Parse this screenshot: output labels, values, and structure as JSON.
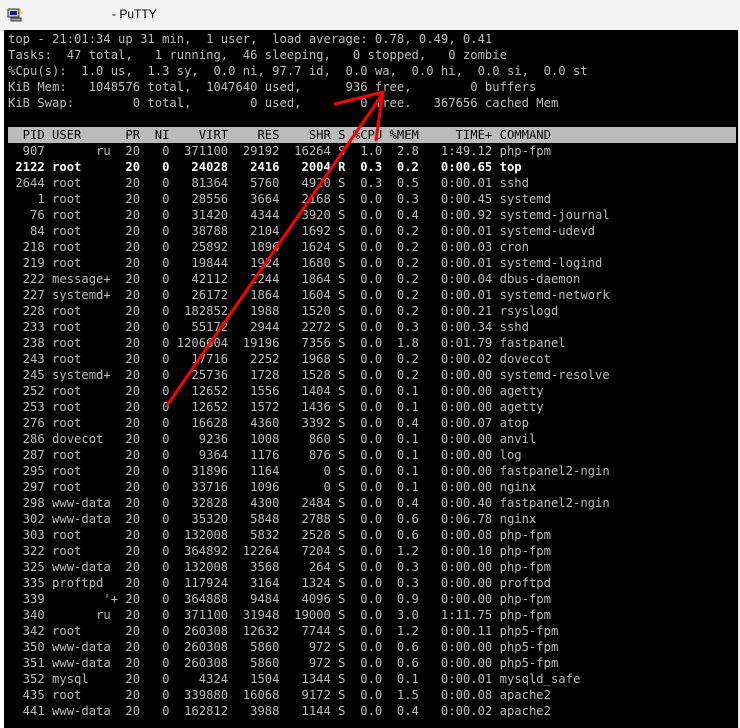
{
  "window": {
    "title": "- PuTTY",
    "accent_color": "#ff0000"
  },
  "summary": [
    "top - 21:01:34 up 31 min,  1 user,  load average: 0.78, 0.49, 0.41",
    "Tasks:  47 total,   1 running,  46 sleeping,   0 stopped,   0 zombie",
    "%Cpu(s):  1.0 us,  1.3 sy,  0.0 ni, 97.7 id,  0.0 wa,  0.0 hi,  0.0 si,  0.0 st",
    "KiB Mem:   1048576 total,  1047640 used,      936 free,        0 buffers",
    "KiB Swap:        0 total,        0 used,        0 free.   367656 cached Mem"
  ],
  "header": "  PID USER      PR  NI    VIRT    RES    SHR S %CPU %MEM     TIME+ COMMAND",
  "processes": [
    "  907       ru  20   0  371100  29192  16264 S  1.0  2.8   1:49.12 php-fpm",
    " 2122 root      20   0   24028   2416   2004 R  0.3  0.2   0:00.65 top",
    " 2644 root      20   0   81364   5760   4920 S  0.3  0.5   0:00.01 sshd",
    "    1 root      20   0   28556   3664   2168 S  0.0  0.3   0:00.45 systemd",
    "   76 root      20   0   31420   4344   3920 S  0.0  0.4   0:00.92 systemd-journal",
    "   84 root      20   0   38788   2104   1692 S  0.0  0.2   0:00.01 systemd-udevd",
    "  218 root      20   0   25892   1896   1624 S  0.0  0.2   0:00.03 cron",
    "  219 root      20   0   19844   1924   1680 S  0.0  0.2   0:00.01 systemd-logind",
    "  222 message+  20   0   42112   2244   1864 S  0.0  0.2   0:00.04 dbus-daemon",
    "  227 systemd+  20   0   26172   1864   1604 S  0.0  0.2   0:00.01 systemd-network",
    "  228 root      20   0  182852   1988   1520 S  0.0  0.2   0:00.21 rsyslogd",
    "  233 root      20   0   55172   2944   2272 S  0.0  0.3   0:00.34 sshd",
    "  238 root      20   0 1206604  19196   7356 S  0.0  1.8   0:01.79 fastpanel",
    "  243 root      20   0   17716   2252   1968 S  0.0  0.2   0:00.02 dovecot",
    "  245 systemd+  20   0   25736   1728   1528 S  0.0  0.2   0:00.00 systemd-resolve",
    "  252 root      20   0   12652   1556   1404 S  0.0  0.1   0:00.00 agetty",
    "  253 root      20   0   12652   1572   1436 S  0.0  0.1   0:00.00 agetty",
    "  276 root      20   0   16628   4360   3392 S  0.0  0.4   0:00.07 atop",
    "  286 dovecot   20   0    9236   1008    860 S  0.0  0.1   0:00.00 anvil",
    "  287 root      20   0    9364   1176    876 S  0.0  0.1   0:00.00 log",
    "  295 root      20   0   31896   1164      0 S  0.0  0.1   0:00.00 fastpanel2-ngin",
    "  297 root      20   0   33716   1096      0 S  0.0  0.1   0:00.00 nginx",
    "  298 www-data  20   0   32828   4300   2484 S  0.0  0.4   0:00.40 fastpanel2-ngin",
    "  302 www-data  20   0   35320   5848   2788 S  0.0  0.6   0:06.78 nginx",
    "  303 root      20   0  132008   5832   2528 S  0.0  0.6   0:00.08 php-fpm",
    "  322 root      20   0  364892  12264   7204 S  0.0  1.2   0:00.10 php-fpm",
    "  325 www-data  20   0  132008   3568    264 S  0.0  0.3   0:00.00 php-fpm",
    "  335 proftpd   20   0  117924   3164   1324 S  0.0  0.3   0:00.00 proftpd",
    "  339        '+ 20   0  364888   9484   4096 S  0.0  0.9   0:00.00 php-fpm",
    "  340       ru  20   0  371100  31948  19000 S  0.0  3.0   1:11.75 php-fpm",
    "  342 root      20   0  260308  12632   7744 S  0.0  1.2   0:00.11 php5-fpm",
    "  350 www-data  20   0  260308   5860    972 S  0.0  0.6   0:00.00 php5-fpm",
    "  351 www-data  20   0  260308   5860    972 S  0.0  0.6   0:00.00 php5-fpm",
    "  352 mysql     20   0    4324   1504   1344 S  0.0  0.1   0:00.01 mysqld_safe",
    "  435 root      20   0  339880  16068   9172 S  0.0  1.5   0:00.08 apache2",
    "  441 www-data  20   0  162812   3988   1144 S  0.0  0.4   0:00.02 apache2"
  ]
}
